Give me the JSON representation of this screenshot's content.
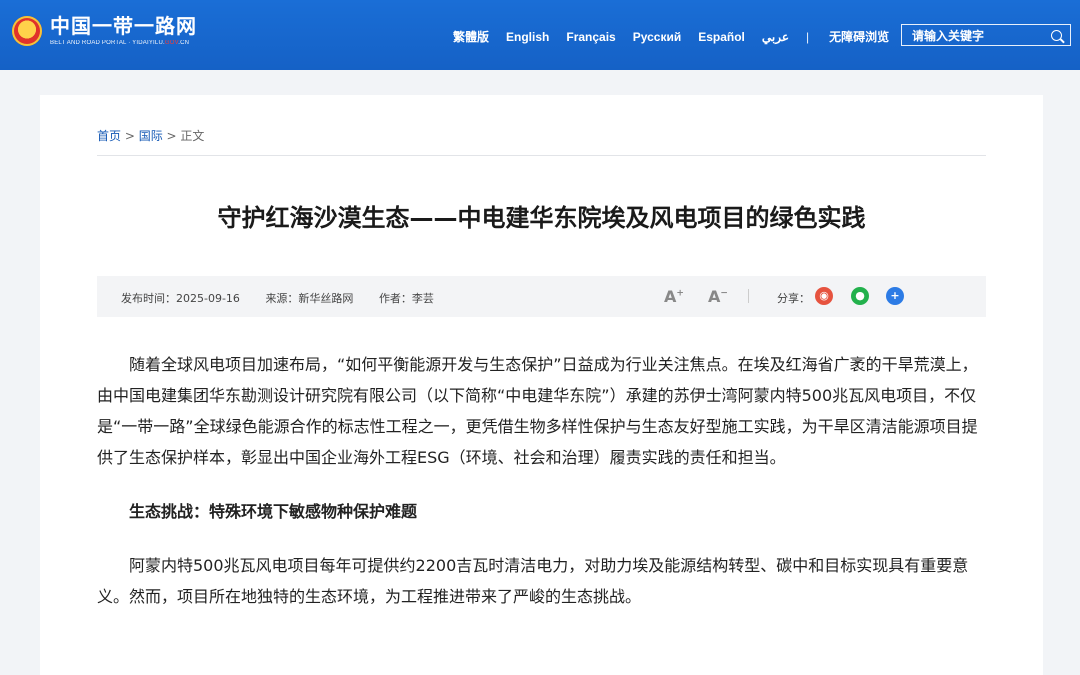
{
  "header": {
    "logo_cn": "中国一带一路网",
    "logo_en_pre": "BELT AND ROAD PORTAL · YIDAIYILU.",
    "logo_en_red": "GOV",
    "logo_en_post": ".CN",
    "nav": [
      "繁體版",
      "English",
      "Français",
      "Русский",
      "Español",
      "عربي"
    ],
    "separator": "|",
    "accessibility": "无障碍浏览",
    "search_placeholder": "请输入关键字"
  },
  "breadcrumb": {
    "home": "首页",
    "section": "国际",
    "current": "正文",
    "sep": " > "
  },
  "article": {
    "title": "守护红海沙漠生态——中电建华东院埃及风电项目的绿色实践",
    "publish_time": "发布时间：2025-09-16",
    "source": "来源：新华丝路网",
    "author": "作者：李芸",
    "font_increase": "A",
    "font_decrease": "A",
    "share_label": "分享：",
    "paragraph1": "随着全球风电项目加速布局，“如何平衡能源开发与生态保护”日益成为行业关注焦点。在埃及红海省广袤的干旱荒漠上，由中国电建集团华东勘测设计研究院有限公司（以下简称“中电建华东院”）承建的苏伊士湾阿蒙内特500兆瓦风电项目，不仅是“一带一路”全球绿色能源合作的标志性工程之一，更凭借生物多样性保护与生态友好型施工实践，为干旱区清洁能源项目提供了生态保护样本，彰显出中国企业海外工程ESG（环境、社会和治理）履责实践的责任和担当。",
    "subheading": "生态挑战：特殊环境下敏感物种保护难题",
    "paragraph2": "阿蒙内特500兆瓦风电项目每年可提供约2200吉瓦时清洁电力，对助力埃及能源结构转型、碳中和目标实现具有重要意义。然而，项目所在地独特的生态环境，为工程推进带来了严峻的生态挑战。"
  },
  "colors": {
    "header_blue": "#1a6ed6",
    "link_blue": "#1559b5",
    "weibo": "#e6533f",
    "wechat": "#22b14c",
    "share_more": "#2c7be5"
  }
}
